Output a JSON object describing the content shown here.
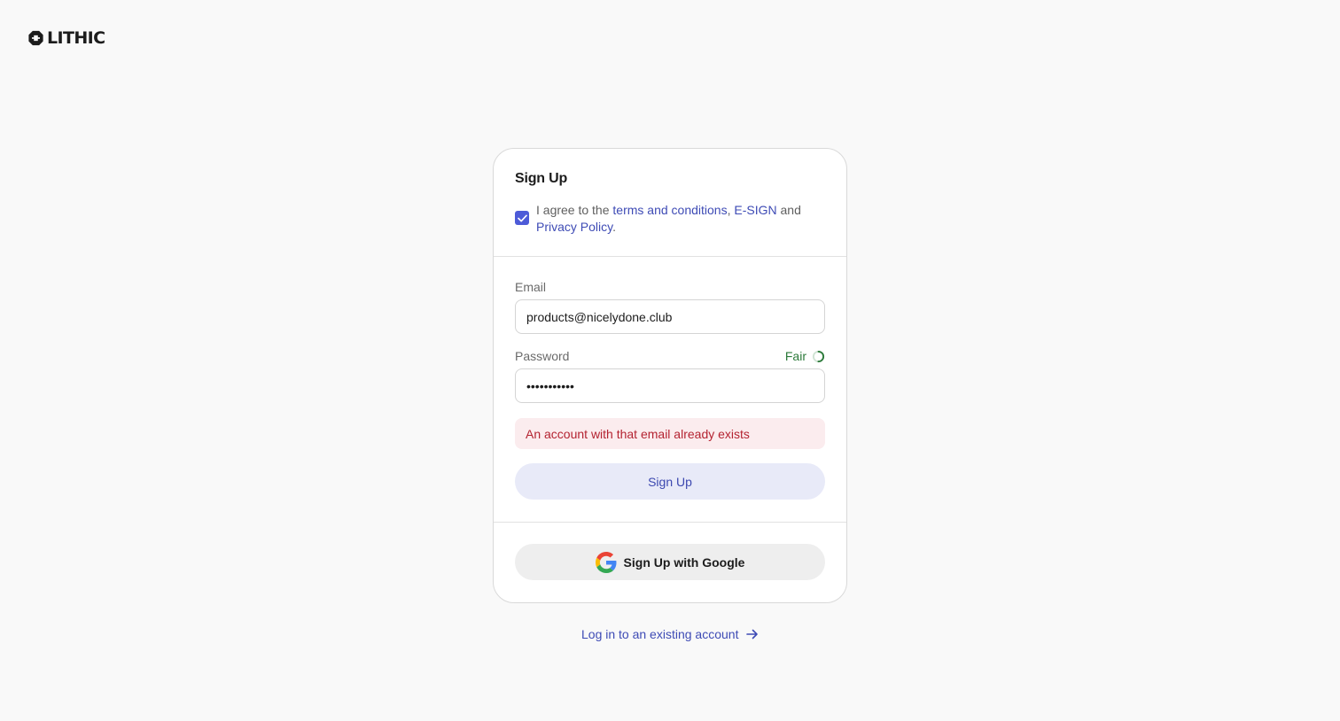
{
  "brand": {
    "logo_text": "LITHIC"
  },
  "card": {
    "title": "Sign Up",
    "agree": {
      "checked": true,
      "prefix": "I agree to the ",
      "terms_link": "terms and conditions",
      "sep1": ", ",
      "esign_link": "E-SIGN",
      "sep2": " and ",
      "privacy_link": "Privacy Policy",
      "suffix": "."
    },
    "email": {
      "label": "Email",
      "value": "products@nicelydone.club"
    },
    "password": {
      "label": "Password",
      "value": "•••••••••••",
      "strength": "Fair",
      "strength_level": 0.5
    },
    "error": "An account with that email already exists",
    "submit_label": "Sign Up",
    "google_label": "Sign Up with Google"
  },
  "footer": {
    "login_link": "Log in to an existing account"
  },
  "colors": {
    "accent": "#4d5bd8",
    "link": "#3e4bb5",
    "error_text": "#b42331",
    "error_bg": "#fbecee",
    "strength": "#2c7a3a"
  },
  "icons": [
    "lithic-logo-icon",
    "checkmark-icon",
    "strength-ring-icon",
    "google-icon",
    "arrow-right-icon"
  ]
}
